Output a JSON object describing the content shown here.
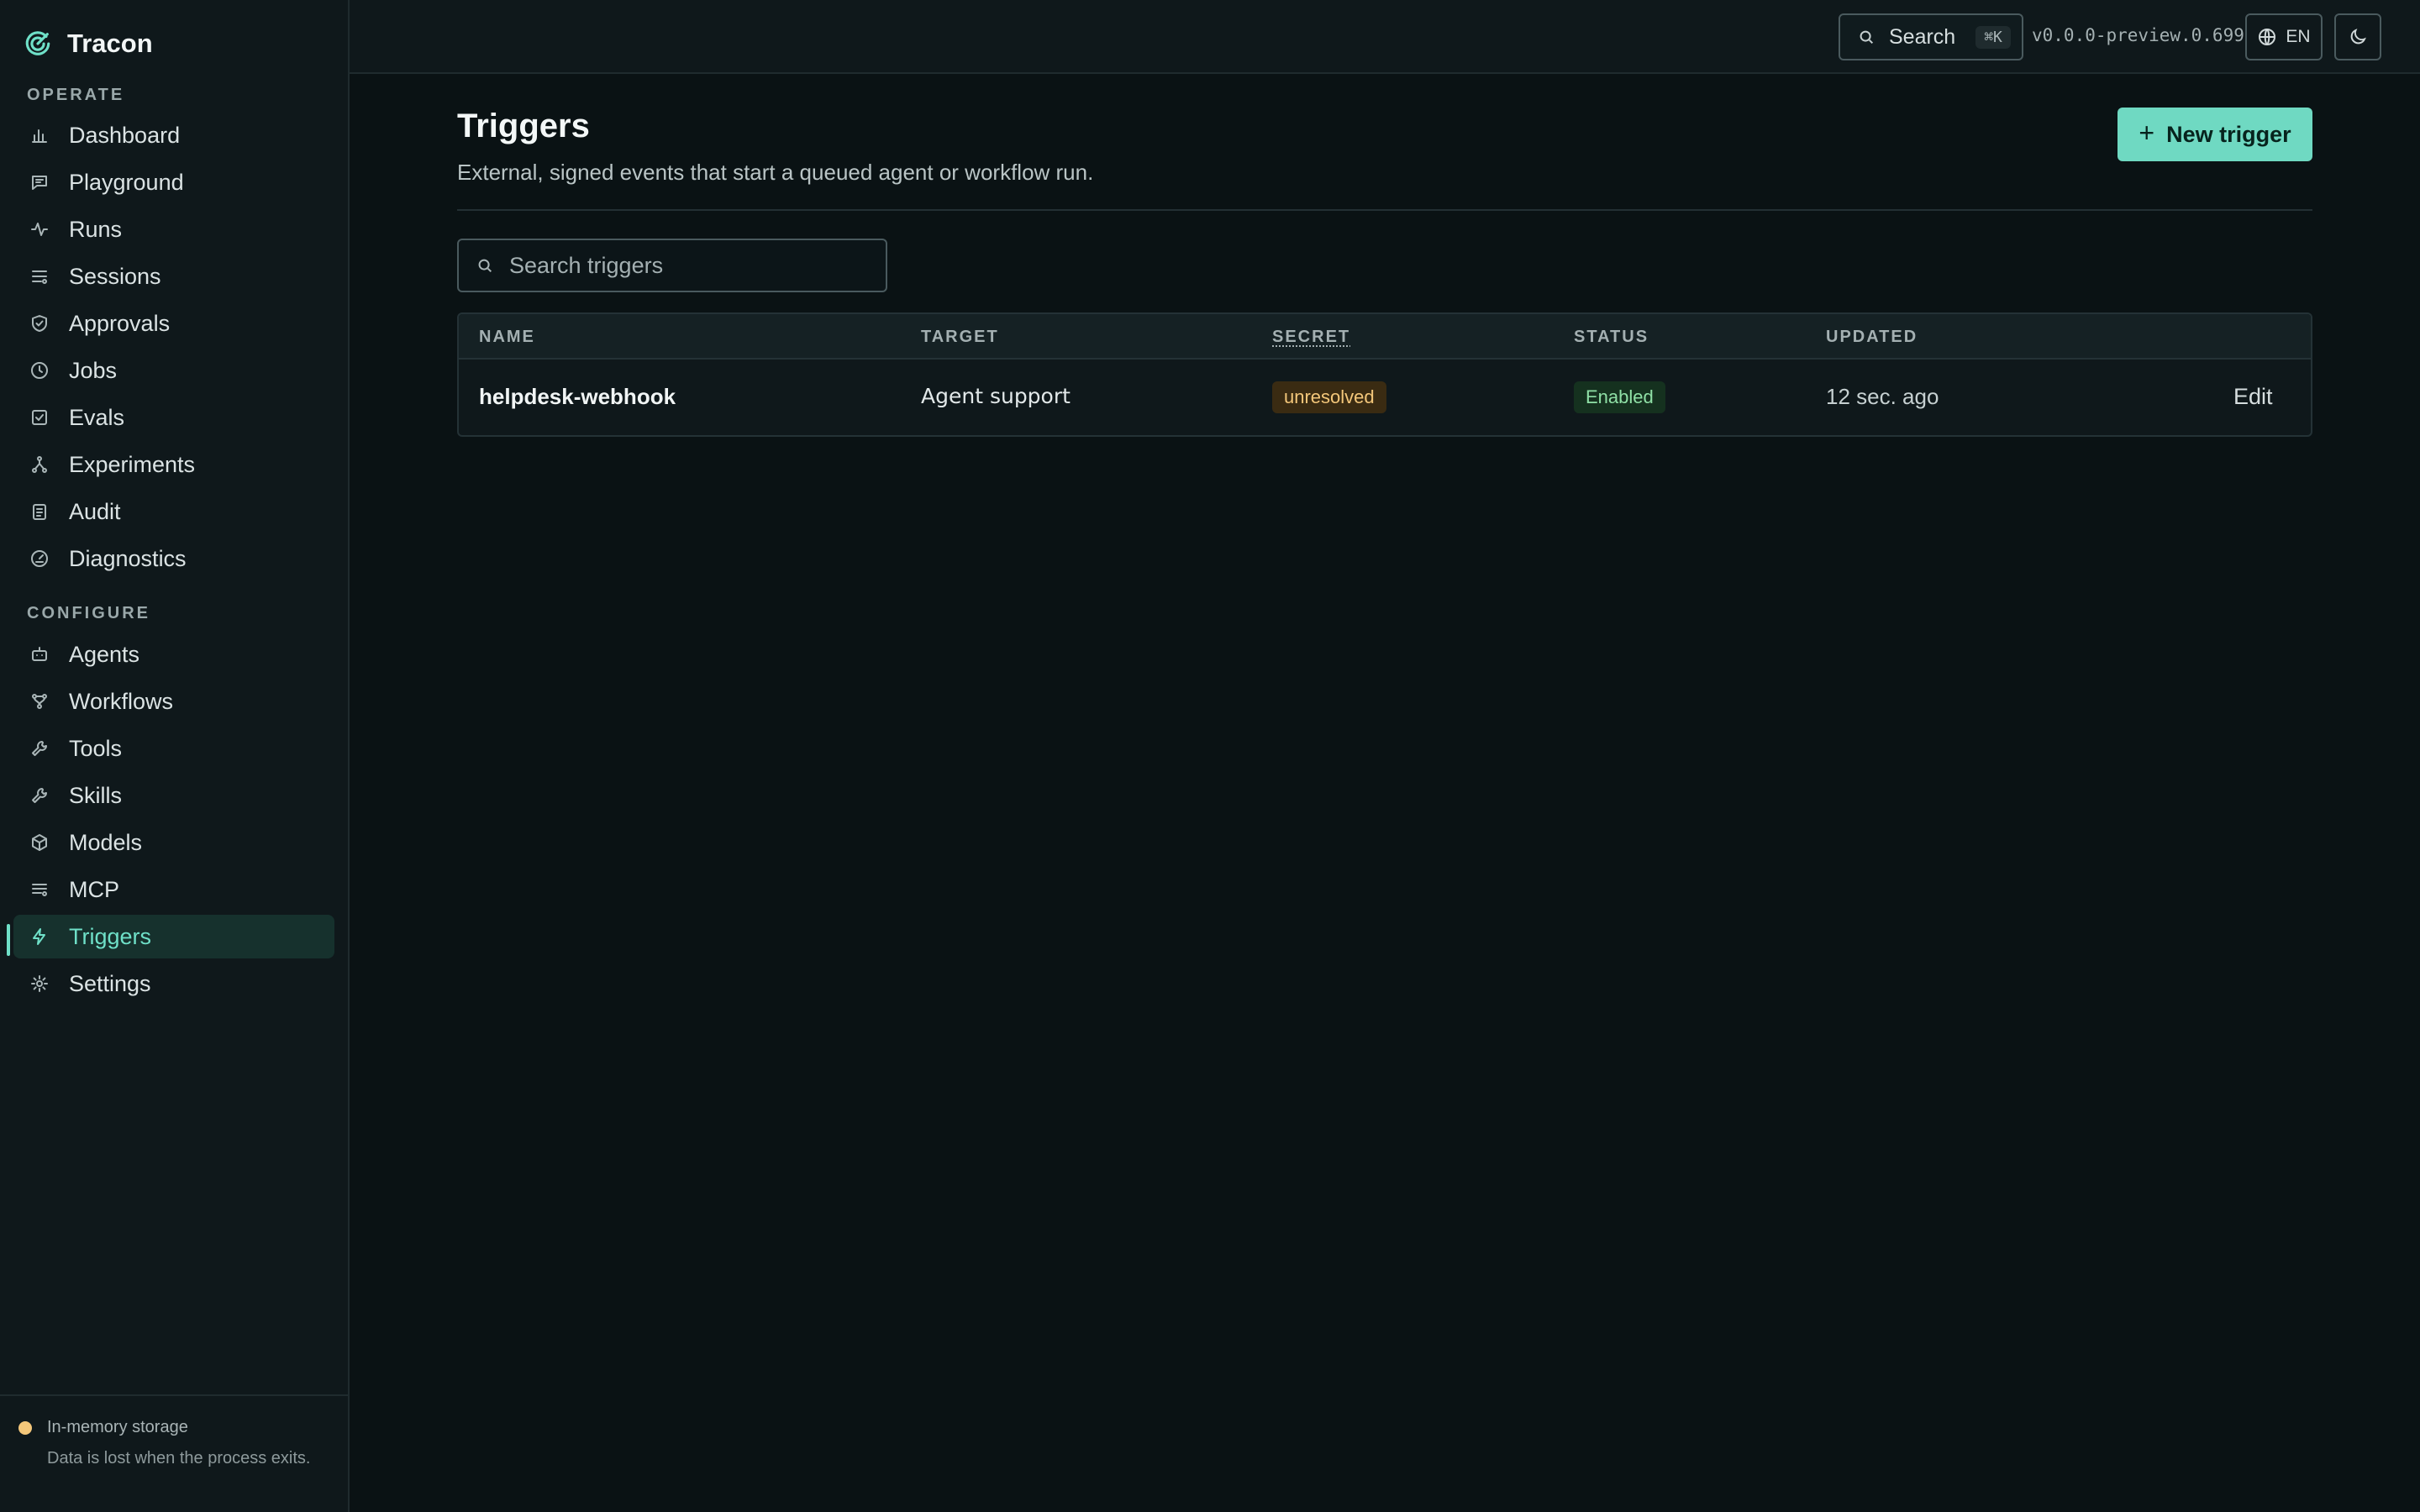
{
  "app": {
    "name": "Tracon"
  },
  "sidebar": {
    "operate_label": "OPERATE",
    "configure_label": "CONFIGURE",
    "operate_items": [
      {
        "label": "Dashboard",
        "icon": "bar-chart-icon"
      },
      {
        "label": "Playground",
        "icon": "chat-icon"
      },
      {
        "label": "Runs",
        "icon": "activity-icon"
      },
      {
        "label": "Sessions",
        "icon": "list-icon"
      },
      {
        "label": "Approvals",
        "icon": "shield-check-icon"
      },
      {
        "label": "Jobs",
        "icon": "clock-icon"
      },
      {
        "label": "Evals",
        "icon": "check-square-icon"
      },
      {
        "label": "Experiments",
        "icon": "branch-icon"
      },
      {
        "label": "Audit",
        "icon": "clipboard-icon"
      },
      {
        "label": "Diagnostics",
        "icon": "gauge-icon"
      }
    ],
    "configure_items": [
      {
        "label": "Agents",
        "icon": "robot-icon"
      },
      {
        "label": "Workflows",
        "icon": "workflow-icon"
      },
      {
        "label": "Tools",
        "icon": "wrench-icon"
      },
      {
        "label": "Skills",
        "icon": "wrench-icon"
      },
      {
        "label": "Models",
        "icon": "cube-icon"
      },
      {
        "label": "MCP",
        "icon": "server-list-icon"
      },
      {
        "label": "Triggers",
        "icon": "lightning-icon",
        "active": true
      },
      {
        "label": "Settings",
        "icon": "sun-gear-icon"
      }
    ],
    "footer": {
      "title": "In-memory storage",
      "description": "Data is lost when the process exits.",
      "status_color": "#f4c77a"
    }
  },
  "topbar": {
    "search_label": "Search",
    "search_shortcut": "⌘K",
    "version": "v0.0.0-preview.0.699",
    "language": "EN"
  },
  "page": {
    "title": "Triggers",
    "subtitle": "External, signed events that start a queued agent or workflow run.",
    "new_button_label": "New trigger",
    "search_placeholder": "Search triggers"
  },
  "table": {
    "columns": [
      "NAME",
      "TARGET",
      "SECRET",
      "STATUS",
      "UPDATED"
    ],
    "rows": [
      {
        "name": "helpdesk-webhook",
        "target": "Agent support",
        "secret": "unresolved",
        "status": "Enabled",
        "updated": "12 sec. ago",
        "action": "Edit"
      }
    ]
  },
  "colors": {
    "accent": "#6fd9c2",
    "background": "#0a1214",
    "sidebar": "#0f181b",
    "warning": "#f4c77a",
    "success": "#8fe0a6"
  }
}
